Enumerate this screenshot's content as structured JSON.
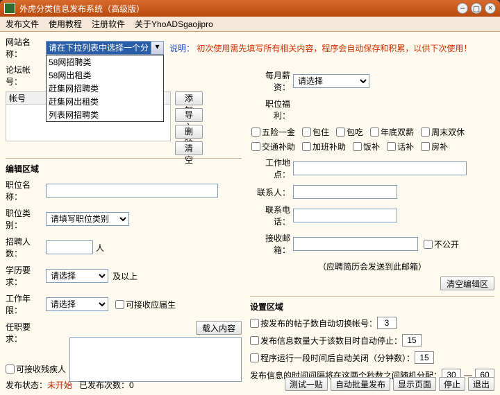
{
  "window": {
    "title": "外虎分类信息发布系统（高级版）"
  },
  "menu": {
    "file": "发布文件",
    "tutorial": "使用教程",
    "register": "注册软件",
    "about": "关于YhoADSgaojipro"
  },
  "top": {
    "site_label": "网站名称：",
    "dropdown_placeholder": "请在下拉列表中选择一个分类",
    "dropdown_options": [
      "58网招聘类",
      "58网出租类",
      "赶集网招聘类",
      "赶集网出租类",
      "列表网招聘类"
    ],
    "note_head": "说明：",
    "note_body": "初次使用需先填写所有相关内容，程序会自动保存和积累，以供下次使用！",
    "forum_label": "论坛帐号：",
    "acct_header": "帐号",
    "btn_add": "添加",
    "btn_import": "导入",
    "btn_del": "删除",
    "btn_clear": "清空"
  },
  "edit": {
    "section": "编辑区域",
    "job_name": "职位名称：",
    "job_cat": "职位类别：",
    "job_cat_ph": "请填写职位类别",
    "hire_num": "招聘人数：",
    "hire_unit": "人",
    "edu": "学历要求：",
    "edu_ph": "请选择",
    "edu_suffix": "及以上",
    "exp": "工作年限：",
    "exp_ph": "请选择",
    "exp_chk": "可接收应届生",
    "req": "任职要求：",
    "load_btn": "载入内容",
    "disabled_chk": "可接收残疾人"
  },
  "right": {
    "salary": "每月薪资：",
    "salary_ph": "请选择",
    "welfare": "职位福利：",
    "welfare_items": [
      "五险一金",
      "包住",
      "包吃",
      "年底双薪",
      "周末双休",
      "交通补助",
      "加班补助",
      "饭补",
      "话补",
      "房补"
    ],
    "location": "工作地点：",
    "contact": "联系人：",
    "phone": "联系电话：",
    "email": "接收邮箱：",
    "email_chk": "不公开",
    "email_note": "（应聘简历会发送到此邮箱）",
    "clear_btn": "清空编辑区"
  },
  "settings": {
    "section": "设置区域",
    "s1": "按发布的帖子数自动切换帐号：",
    "s1v": "3",
    "s2": "发布信息数量大于该数目时自动停止：",
    "s2v": "15",
    "s3": "程序运行一段时间后自动关闭（分钟数）：",
    "s3v": "15",
    "s4": "发布信息的时间间隔将在这两个秒数之间随机分配：",
    "s4a": "30",
    "s4b": "60",
    "dash": "—"
  },
  "status": {
    "label": "发布状态：",
    "value": "未开始",
    "count_label": "已发布次数：",
    "count_value": "0"
  },
  "actions": {
    "test": "测试一贴",
    "batch": "自动批量发布",
    "show": "显示页面",
    "stop": "停止",
    "exit": "退出"
  }
}
